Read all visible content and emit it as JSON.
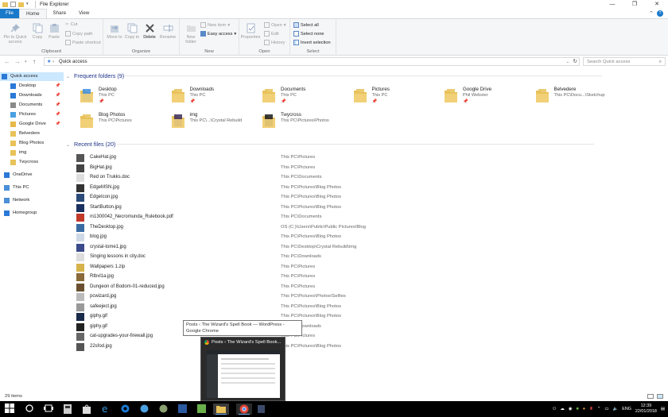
{
  "window": {
    "title": "File Explorer",
    "controls": [
      "—",
      "❐",
      "✕"
    ]
  },
  "ribbon": {
    "tabs": [
      "File",
      "Home",
      "Share",
      "View"
    ],
    "clipboard": {
      "label": "Clipboard",
      "pin": "Pin to Quick access",
      "copy": "Copy",
      "paste": "Paste",
      "cut": "Cut",
      "copy_path": "Copy path",
      "paste_shortcut": "Paste shortcut"
    },
    "organize": {
      "label": "Organize",
      "move_to": "Move to",
      "copy_to": "Copy to",
      "delete": "Delete",
      "rename": "Rename"
    },
    "new": {
      "label": "New",
      "new_folder": "New folder",
      "new_item": "New item",
      "easy_access": "Easy access"
    },
    "open": {
      "label": "Open",
      "properties": "Properties",
      "open": "Open",
      "edit": "Edit",
      "history": "History"
    },
    "select": {
      "label": "Select",
      "select_all": "Select all",
      "select_none": "Select none",
      "invert": "Invert selection"
    }
  },
  "address": {
    "path": "Quick access",
    "search_placeholder": "Search Quick access"
  },
  "nav": {
    "items": [
      {
        "label": "Quick access",
        "icon": "star-icon",
        "color": "#2b79d6"
      },
      {
        "label": "Desktop",
        "icon": "desktop-icon",
        "color": "#2b79d6",
        "pin": "📌"
      },
      {
        "label": "Downloads",
        "icon": "download-icon",
        "color": "#2b79d6",
        "pin": "📌"
      },
      {
        "label": "Documents",
        "icon": "documents-icon",
        "color": "#8a8a8a",
        "pin": "📌"
      },
      {
        "label": "Pictures",
        "icon": "pictures-icon",
        "color": "#4aa0e0",
        "pin": "📌"
      },
      {
        "label": "Google Drive",
        "icon": "google-drive-icon",
        "color": "#e8b84a",
        "pin": "📌"
      },
      {
        "label": "Belvedere",
        "icon": "folder-icon",
        "color": "#e8c25a"
      },
      {
        "label": "Blog Photos",
        "icon": "folder-icon",
        "color": "#e8c25a"
      },
      {
        "label": "img",
        "icon": "folder-icon",
        "color": "#e8c25a"
      },
      {
        "label": "Twycross",
        "icon": "folder-icon",
        "color": "#e8c25a"
      },
      {
        "label": "OneDrive",
        "icon": "onedrive-icon",
        "color": "#2b79d6"
      },
      {
        "label": "This PC",
        "icon": "computer-icon",
        "color": "#4a8fd8"
      },
      {
        "label": "Network",
        "icon": "network-icon",
        "color": "#4a8fd8"
      },
      {
        "label": "Homegroup",
        "icon": "homegroup-icon",
        "color": "#2b79d6"
      }
    ]
  },
  "frequent": {
    "header": "Frequent folders (9)",
    "folders": [
      {
        "name": "Desktop",
        "sub": "This PC",
        "pin": "📌",
        "color": "#3d8ee0"
      },
      {
        "name": "Downloads",
        "sub": "This PC",
        "pin": "📌",
        "color": "#e8c25a"
      },
      {
        "name": "Documents",
        "sub": "This PC",
        "pin": "📌",
        "color": "#e8c25a"
      },
      {
        "name": "Pictures",
        "sub": "This PC",
        "pin": "📌",
        "color": "#e8c25a"
      },
      {
        "name": "Google Drive",
        "sub": "Phil Webster",
        "pin": "📌",
        "color": "#e8c25a"
      },
      {
        "name": "Belvedere",
        "sub": "This PC\\Docu...\\Sketchup",
        "pin": "",
        "color": "#e8c25a"
      },
      {
        "name": "Blog Photos",
        "sub": "This PC\\Pictures",
        "pin": "",
        "color": "#e8c25a"
      },
      {
        "name": "img",
        "sub": "This PC\\...\\Crystal Rebuild",
        "pin": "",
        "color": "#3b2a5a"
      },
      {
        "name": "Twycross",
        "sub": "This PC\\Pictures\\Photos",
        "pin": "",
        "color": "#1a1a1a"
      }
    ]
  },
  "recent": {
    "header": "Recent files (20)",
    "files": [
      {
        "name": "CakeHat.jpg",
        "loc": "This PC\\Pictures",
        "color": "#555"
      },
      {
        "name": "BigHat.jpg",
        "loc": "This PC\\Pictures",
        "color": "#444"
      },
      {
        "name": "Red on Trukks.doc",
        "loc": "This PC\\Documents",
        "color": "#ddd"
      },
      {
        "name": "EdgeMSN.jpg",
        "loc": "This PC\\Pictures\\Blog Photos",
        "color": "#333"
      },
      {
        "name": "EdgeIcon.jpg",
        "loc": "This PC\\Pictures\\Blog Photos",
        "color": "#2a4a7a"
      },
      {
        "name": "StartButton.jpg",
        "loc": "This PC\\Pictures\\Blog Photos",
        "color": "#1a3060"
      },
      {
        "name": "m1300042_Necromunda_Rulebook.pdf",
        "loc": "This PC\\Documents",
        "color": "#c0392b"
      },
      {
        "name": "TheDesktop.jpg",
        "loc": "OS (C:)\\Users\\Public\\Public Pictures\\Blog",
        "color": "#3a6aa0"
      },
      {
        "name": "blog.jpg",
        "loc": "This PC\\Pictures\\Blog Photos",
        "color": "#cfd8e6"
      },
      {
        "name": "crystal-tome1.jpg",
        "loc": "This PC\\Desktop\\Crystal Rebuild\\img",
        "color": "#3b4a8a"
      },
      {
        "name": "Singing lessons in city.doc",
        "loc": "This PC\\Downloads",
        "color": "#ddd"
      },
      {
        "name": "Wallpapers 1.zip",
        "loc": "This PC\\Pictures",
        "color": "#d6b24a"
      },
      {
        "name": "Rtbvl1a.jpg",
        "loc": "This PC\\Pictures",
        "color": "#8a6a3a"
      },
      {
        "name": "Dungeon of Bodom-01-reduced.jpg",
        "loc": "This PC\\Pictures",
        "color": "#6a5030"
      },
      {
        "name": "pcwizard.jpg",
        "loc": "This PC\\Pictures\\Photos\\Selfies",
        "color": "#bbb"
      },
      {
        "name": "safeeject.jpg",
        "loc": "This PC\\Pictures\\Blog Photos",
        "color": "#999"
      },
      {
        "name": "giphy.gif",
        "loc": "This PC\\Pictures\\Blog Photos",
        "color": "#1a2a4a"
      },
      {
        "name": "giphy.gif",
        "loc": "This PC\\Downloads",
        "color": "#222"
      },
      {
        "name": "cat-upgrades-your-firewall.jpg",
        "loc": "This PC\\Pictures",
        "color": "#666"
      },
      {
        "name": "22sfod.jpg",
        "loc": "This PC\\Pictures\\Blog Photos",
        "color": "#555"
      }
    ]
  },
  "status": {
    "items": "29 items"
  },
  "tooltip": {
    "text": "Posts ‹ The Wizard's Spell Book — WordPress - Google Chrome"
  },
  "preview": {
    "title": "Posts ‹ The Wizard's Spell Book..."
  },
  "taskbar": {
    "lang": "ENG",
    "time": "12:39",
    "date": "22/01/2018"
  }
}
